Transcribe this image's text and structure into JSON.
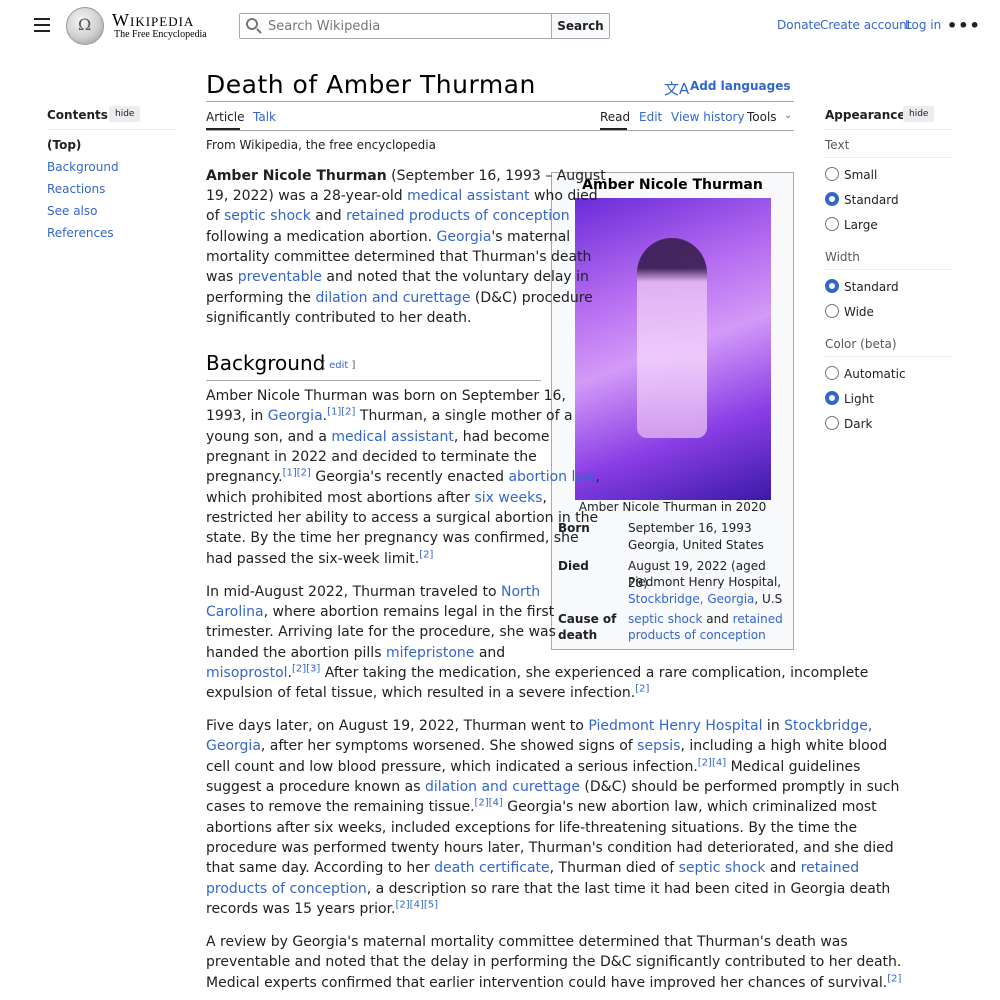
{
  "header": {
    "wordmark": "Wikipedia",
    "tagline": "The Free Encyclopedia",
    "search_placeholder": "Search Wikipedia",
    "search_button": "Search",
    "donate": "Donate",
    "create_account": "Create account",
    "log_in": "Log in",
    "more": "•••"
  },
  "title": "Death of Amber Thurman",
  "add_languages": "Add languages",
  "tabs": {
    "article": "Article",
    "talk": "Talk",
    "read": "Read",
    "edit": "Edit",
    "view_history": "View history",
    "tools": "Tools"
  },
  "from_wikipedia": "From Wikipedia, the free encyclopedia",
  "toc": {
    "title": "Contents",
    "hide": "hide",
    "items": [
      "(Top)",
      "Background",
      "Reactions",
      "See also",
      "References"
    ]
  },
  "appearance": {
    "title": "Appearance",
    "hide": "hide",
    "text_label": "Text",
    "text_options": [
      "Small",
      "Standard",
      "Large"
    ],
    "width_label": "Width",
    "width_options": [
      "Standard",
      "Wide"
    ],
    "color_label": "Color (beta)",
    "color_options": [
      "Automatic",
      "Light",
      "Dark"
    ]
  },
  "infobox": {
    "title": "Amber Nicole Thurman",
    "caption": "Amber Nicole Thurman in 2020",
    "born_label": "Born",
    "born_date": "September 16, 1993",
    "born_place": "Georgia, United States",
    "died_label": "Died",
    "died_date": "August 19, 2022 (aged 28)",
    "died_place1": "Piedmont Henry Hospital,",
    "died_place_link": "Stockbridge, Georgia",
    "died_place_tail": ", U.S",
    "cause_label1": "Cause of",
    "cause_label2": "death",
    "cause_link1": "septic shock",
    "cause_and": " and ",
    "cause_link2a": "retained",
    "cause_link2b": "products of conception"
  },
  "section_background": {
    "heading": "Background",
    "edit_open": "[ ",
    "edit": "edit",
    "edit_close": " ]"
  },
  "lead": {
    "p1": "Amber Nicole Thurman",
    "p2": " (September 16, 1993 – August",
    "p3": "19, 2022) was a 28-year-old ",
    "p3_link": "medical assistant",
    "p3_tail": " who died",
    "p4": "of ",
    "p4_link1": "septic shock",
    "p4_mid": " and ",
    "p4_link2": "retained products of conception",
    "p5": "following a medication abortion. ",
    "p5_link": "Georgia",
    "p5_tail": "'s maternal",
    "p6": "mortality committee determined that Thurman's death",
    "p7": "was ",
    "p7_link": "preventable",
    "p7_tail": " and noted that the voluntary delay in",
    "p8": "performing the ",
    "p8_link": "dilation and curettage",
    "p8_tail": " (D&C) procedure",
    "p9": "significantly contributed to her death."
  },
  "bg1": {
    "l1": "Amber Nicole Thurman was born on September 16,",
    "l2": "1993, in ",
    "l2_link": "Georgia",
    "l2_sup": "[1][2]",
    "l2_tail": " Thurman, a single mother of a",
    "l3": "young son, and a ",
    "l3_link": "medical assistant",
    "l3_tail": ", had become",
    "l4": "pregnant in 2022 and decided to terminate the",
    "l5": "pregnancy.",
    "l5_sup": "[1][2]",
    "l5_mid": " Georgia's recently enacted ",
    "l5_link": "abortion law",
    "l5_tail": ",",
    "l6": "which prohibited most abortions after ",
    "l6_link": "six weeks",
    "l6_tail": ",",
    "l7": "restricted her ability to access a surgical abortion in the",
    "l8": "state. By the time her pregnancy was confirmed, she",
    "l9": "had passed the six-week limit.",
    "l9_sup": "[2]"
  },
  "bg2": {
    "l1": "In mid-August 2022, Thurman traveled to ",
    "l1_link": "North",
    "l2_link": "Carolina",
    "l2_tail": ", where abortion remains legal in the first",
    "l3": "trimester. Arriving late for the procedure, she was",
    "l4": "handed the abortion pills ",
    "l4_link": "mifepristone",
    "l4_tail": " and",
    "l5_link": "misoprostol",
    "l5_sup": "[2][3]",
    "l5_tail": " After taking the medication, she experienced a rare complication, incomplete",
    "l6": "expulsion of fetal tissue, which resulted in a severe infection.",
    "l6_sup": "[2]"
  },
  "bg3": {
    "l1": "Five days later, on August 19, 2022, Thurman went to ",
    "l1_link": "Piedmont Henry Hospital",
    "l1_mid": " in ",
    "l1_link2": "Stockbridge,",
    "l2_link": "Georgia",
    "l2_mid": ", after her symptoms worsened. She showed signs of ",
    "l2_link2": "sepsis",
    "l2_tail": ", including a high white blood",
    "l3": "cell count and low blood pressure, which indicated a serious infection.",
    "l3_sup": "[2][4]",
    "l3_tail": " Medical guidelines",
    "l4": "suggest a procedure known as ",
    "l4_link": "dilation and curettage",
    "l4_tail": " (D&C) should be performed promptly in such",
    "l5": "cases to remove the remaining tissue.",
    "l5_sup": "[2][4]",
    "l5_tail": " Georgia's new abortion law, which criminalized most",
    "l6": "abortions after six weeks, included exceptions for life-threatening situations. By the time the",
    "l7": "procedure was performed twenty hours later, Thurman's condition had deteriorated, and she died",
    "l8": "that same day. According to her ",
    "l8_link": "death certificate",
    "l8_mid": ", Thurman died of ",
    "l8_link2": "septic shock",
    "l8_mid2": " and ",
    "l8_link3": "retained",
    "l9_link": "products of conception",
    "l9_tail": ", a description so rare that the last time it had been cited in Georgia death",
    "l10": "records was 15 years prior.",
    "l10_sup": "[2][4][5]"
  },
  "bg4": {
    "l1": "A review by Georgia's maternal mortality committee determined that Thurman's death was",
    "l2": "preventable and noted that the delay in performing the D&C significantly contributed to her death.",
    "l3": "Medical experts confirmed that earlier intervention could have improved her chances of survival.",
    "l3_sup": "[2]"
  }
}
